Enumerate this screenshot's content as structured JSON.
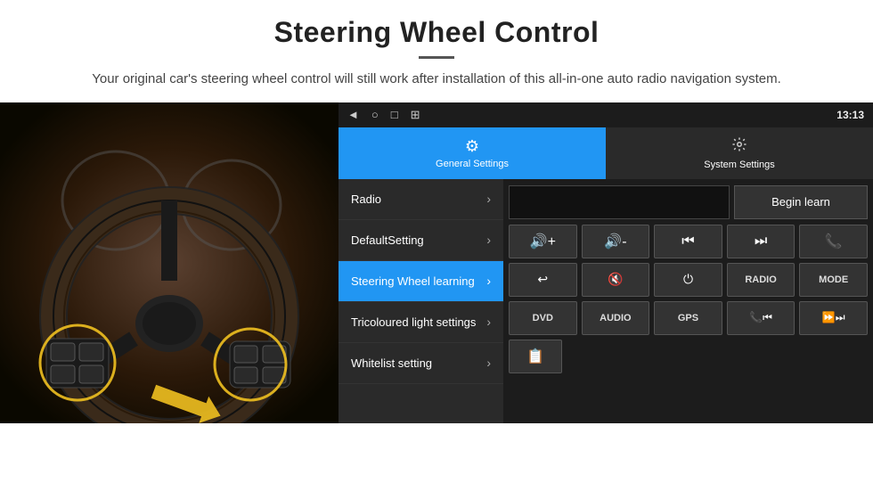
{
  "header": {
    "title": "Steering Wheel Control",
    "divider": "",
    "subtitle": "Your original car's steering wheel control will still work after installation of this all-in-one auto radio navigation system."
  },
  "status_bar": {
    "time": "13:13",
    "icons": [
      "◄",
      "○",
      "□",
      "⊞"
    ]
  },
  "tabs": [
    {
      "label": "General Settings",
      "icon": "⚙",
      "active": true
    },
    {
      "label": "System Settings",
      "icon": "🔧",
      "active": false
    }
  ],
  "menu": {
    "items": [
      {
        "label": "Radio",
        "active": false
      },
      {
        "label": "DefaultSetting",
        "active": false
      },
      {
        "label": "Steering Wheel learning",
        "active": true
      },
      {
        "label": "Tricoloured light settings",
        "active": false
      },
      {
        "label": "Whitelist setting",
        "active": false
      }
    ]
  },
  "controls": {
    "begin_learn_label": "Begin learn",
    "buttons_row1": [
      "🔊+",
      "🔊-",
      "⏮",
      "⏭",
      "📞"
    ],
    "buttons_row2": [
      "↩",
      "🔊×",
      "⏻",
      "RADIO",
      "MODE"
    ],
    "buttons_row3": [
      "DVD",
      "AUDIO",
      "GPS",
      "📞⏮",
      "⏩⏭"
    ],
    "buttons_row4": [
      "📋"
    ]
  }
}
